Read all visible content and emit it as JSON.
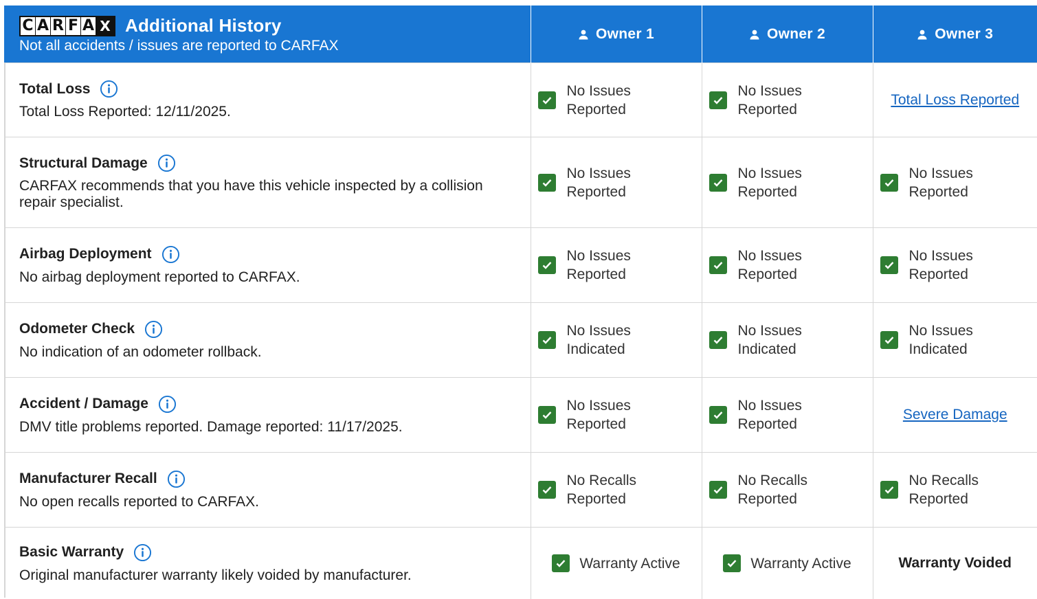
{
  "header": {
    "logo_letters": [
      "C",
      "A",
      "R",
      "F",
      "A",
      "X"
    ],
    "title": "Additional History",
    "subtitle": "Not all accidents / issues are reported to CARFAX",
    "owners": [
      "Owner 1",
      "Owner 2",
      "Owner 3"
    ]
  },
  "rows": [
    {
      "title": "Total Loss",
      "desc": "Total Loss Reported: 12/11/2025.",
      "owner1": "No Issues Reported",
      "owner2": "No Issues Reported",
      "owner3_link": "Total Loss Reported"
    },
    {
      "title": "Structural Damage",
      "desc": "CARFAX recommends that you have this vehicle inspected by a collision repair specialist.",
      "owner1": "No Issues Reported",
      "owner2": "No Issues Reported",
      "owner3": "No Issues Reported"
    },
    {
      "title": "Airbag Deployment",
      "desc": "No airbag deployment reported to CARFAX.",
      "owner1": "No Issues Reported",
      "owner2": "No Issues Reported",
      "owner3": "No Issues Reported"
    },
    {
      "title": "Odometer Check",
      "desc": "No indication of an odometer rollback.",
      "owner1": "No Issues Indicated",
      "owner2": "No Issues Indicated",
      "owner3": "No Issues Indicated"
    },
    {
      "title": "Accident / Damage",
      "desc": "DMV title problems reported. Damage reported: 11/17/2025.",
      "owner1": "No Issues Reported",
      "owner2": "No Issues Reported",
      "owner3_link": "Severe Damage"
    },
    {
      "title": "Manufacturer Recall",
      "desc": "No open recalls reported to CARFAX.",
      "owner1": "No Recalls Reported",
      "owner2": "No Recalls Reported",
      "owner3": "No Recalls Reported"
    },
    {
      "title": "Basic Warranty",
      "desc": "Original manufacturer warranty likely voided by manufacturer.",
      "owner1": "Warranty Active",
      "owner2": "Warranty Active",
      "owner3_bold": "Warranty Voided"
    }
  ],
  "colors": {
    "header_blue": "#1976d2",
    "check_green": "#2e7d32",
    "link_blue": "#1565c0",
    "border_gray": "#d6d6d6"
  },
  "icons": {
    "owner": "person-icon",
    "info": "info-icon",
    "status": "check-icon"
  }
}
